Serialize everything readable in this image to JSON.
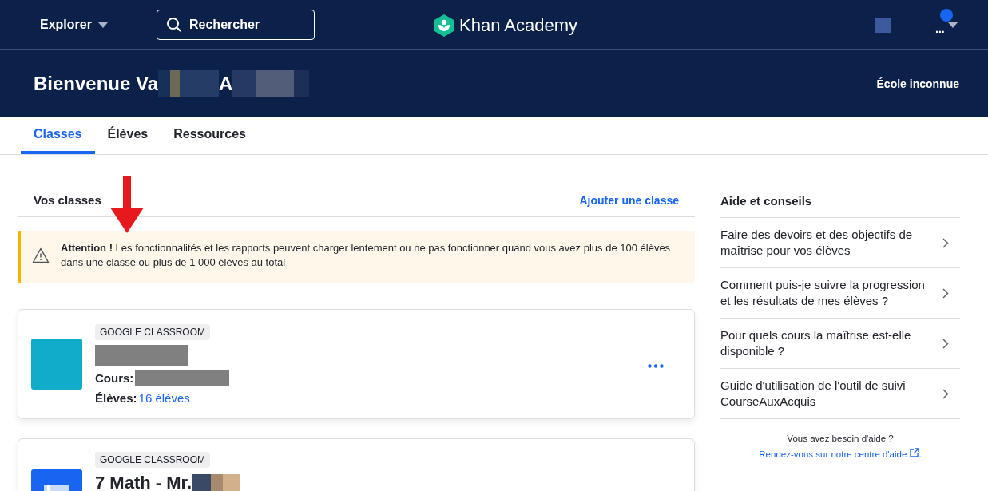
{
  "topbar": {
    "explore": "Explorer",
    "search": {
      "placeholder": "Rechercher"
    },
    "logo": "Khan Academy",
    "account": "..."
  },
  "banner": {
    "greeting": "Bienvenue Va",
    "greeting_2": "A",
    "school": "École inconnue"
  },
  "tabs": [
    {
      "label": "Classes",
      "selected": true
    },
    {
      "label": "Élèves",
      "selected": false
    },
    {
      "label": "Ressources",
      "selected": false
    }
  ],
  "classes": {
    "title": "Vos classes",
    "add": "Ajouter une classe",
    "warning": "**Attention !** Les fonctionnalités et les rapports peuvent charger lentement ou ne pas fonctionner quand vous avez plus de 100 élèves dans une classe ou plus de 1 000 élèves au total",
    "cards": [
      {
        "kind": "plain",
        "color": "#11acca",
        "tag": "GOOGLE CLASSROOM",
        "course_label": "Cours:",
        "students_label": "Élèves:",
        "students": "16 élèves"
      },
      {
        "kind": "book",
        "color": "#1865f2",
        "tag": "GOOGLE CLASSROOM",
        "name": "7 Math - Mr."
      }
    ]
  },
  "help": {
    "title": "Aide et conseils",
    "items": [
      "Faire des devoirs et des objectifs de maîtrise pour vos élèves",
      "Comment puis-je suivre la progression et les résultats de mes élèves ?",
      "Pour quels cours la maîtrise est-elle disponible ?",
      "Guide d'utilisation de l'outil de suivi CourseAuxAcquis"
    ],
    "footer": "Vous avez besoin d'aide ?",
    "footer_link": "Rendez-vous sur notre centre d'aide",
    "footer_end": "."
  }
}
